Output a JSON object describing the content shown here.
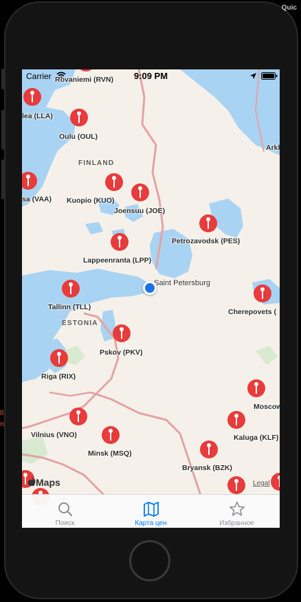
{
  "status_bar": {
    "carrier": "Carrier",
    "time": "9:09 PM"
  },
  "map": {
    "airports": [
      {
        "label": "Rovaniemi (RVN)"
      },
      {
        "label": "lea (LLA)"
      },
      {
        "label": "Oulu (OUL)"
      },
      {
        "label": "Arkh"
      },
      {
        "label": "sa (VAA)"
      },
      {
        "label": "Kuopio (KUO)"
      },
      {
        "label": "Joensuu (JOE)"
      },
      {
        "label": "Petrozavodsk (PES)"
      },
      {
        "label": "Lappeenranta (LPP)"
      },
      {
        "label": "Tallinn (TLL)"
      },
      {
        "label": "Cherepovets ("
      },
      {
        "label": "Pskov (PKV)"
      },
      {
        "label": "Riga (RIX)"
      },
      {
        "label": "Moscow"
      },
      {
        "label": "Vilnius (VNO)"
      },
      {
        "label": "Minsk (MSQ)"
      },
      {
        "label": "Kaluga (KLF)"
      },
      {
        "label": "Bryansk (BZK)"
      }
    ],
    "countries": {
      "finland": "FINLAND",
      "estonia": "ESTONIA"
    },
    "current_city": "Saint Petersburg",
    "attribution": "Maps",
    "legal": "Legal",
    "colors": {
      "pin": "#e83b3b",
      "water": "#a9d3f2",
      "land": "#f5f1ea",
      "border": "#e4a3a3",
      "user_location": "#1a73e8"
    }
  },
  "tabs": [
    {
      "label": "Поиск",
      "icon": "search-icon",
      "active": false
    },
    {
      "label": "Карта цен",
      "icon": "map-icon",
      "active": true
    },
    {
      "label": "Избранное",
      "icon": "star-icon",
      "active": false
    }
  ],
  "background": {
    "app_title": "Quic"
  }
}
